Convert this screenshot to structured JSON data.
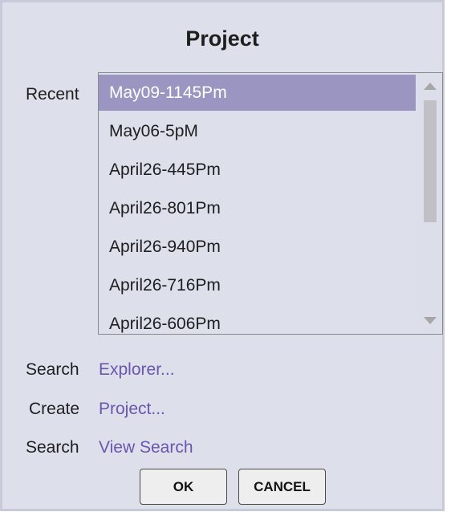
{
  "dialog": {
    "title": "Project",
    "recent_label": "Recent",
    "recent_items": [
      {
        "label": "May09-1145Pm",
        "selected": true
      },
      {
        "label": "May06-5pM",
        "selected": false
      },
      {
        "label": "April26-445Pm",
        "selected": false
      },
      {
        "label": "April26-801Pm",
        "selected": false
      },
      {
        "label": "April26-940Pm",
        "selected": false
      },
      {
        "label": "April26-716Pm",
        "selected": false
      },
      {
        "label": "April26-606Pm",
        "selected": false
      }
    ],
    "actions": [
      {
        "label": "Search",
        "link": "Explorer..."
      },
      {
        "label": "Create",
        "link": "Project..."
      },
      {
        "label": "Search",
        "link": "View Search"
      }
    ],
    "buttons": {
      "ok": "OK",
      "cancel": "CANCEL"
    }
  },
  "colors": {
    "background": "#dddfea",
    "selection": "#9b95c2",
    "link": "#6a55b0"
  }
}
